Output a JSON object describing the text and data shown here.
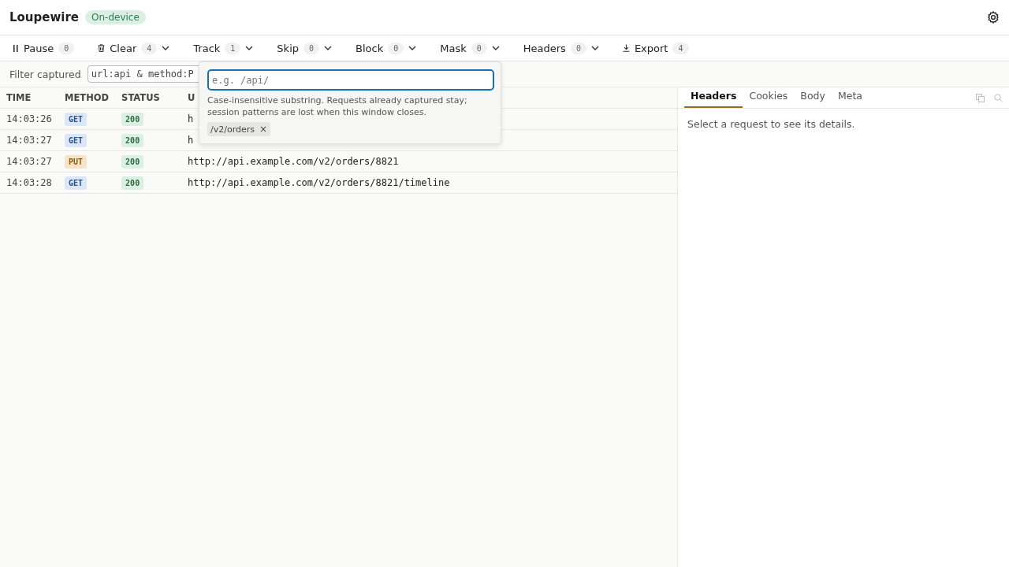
{
  "app": {
    "title": "Loupewire",
    "badge": "On-device"
  },
  "toolbar": [
    {
      "kind": "pause",
      "label": "Pause",
      "count": "0",
      "has_menu": false
    },
    {
      "kind": "trash",
      "label": "Clear",
      "count": "4",
      "has_menu": true
    },
    {
      "kind": "plain",
      "label": "Track",
      "count": "1",
      "has_menu": true
    },
    {
      "kind": "plain",
      "label": "Skip",
      "count": "0",
      "has_menu": true
    },
    {
      "kind": "plain",
      "label": "Block",
      "count": "0",
      "has_menu": true
    },
    {
      "kind": "plain",
      "label": "Mask",
      "count": "0",
      "has_menu": true
    },
    {
      "kind": "plain",
      "label": "Headers",
      "count": "0",
      "has_menu": true
    },
    {
      "kind": "download",
      "label": "Export",
      "count": "4",
      "has_menu": false
    }
  ],
  "filter": {
    "label": "Filter captured",
    "value": "url:api & method:P"
  },
  "table": {
    "columns": [
      "TIME",
      "METHOD",
      "STATUS",
      "U"
    ],
    "rows": [
      {
        "time": "14:03:26",
        "method": "GET",
        "color": "#dbe6f7",
        "status": "200",
        "url": "h"
      },
      {
        "time": "14:03:27",
        "method": "GET",
        "color": "#dbe6f7",
        "status": "200",
        "url": "h"
      },
      {
        "time": "14:03:27",
        "method": "PUT",
        "color": "#f6e4c8",
        "status": "200",
        "url": "http://api.example.com/v2/orders/8821"
      },
      {
        "time": "14:03:28",
        "method": "GET",
        "color": "#dbe6f7",
        "status": "200",
        "url": "http://api.example.com/v2/orders/8821/timeline"
      }
    ]
  },
  "popover": {
    "placeholder": "e.g. /api/",
    "hint": "Case-insensitive substring. Requests already captured stay; session patterns are lost when this window closes.",
    "chips": [
      "/v2/orders"
    ],
    "chip_remove": "×"
  },
  "details": {
    "tabs": [
      {
        "label": "Headers",
        "selected": true
      },
      {
        "label": "Cookies",
        "selected": false
      },
      {
        "label": "Body",
        "selected": false
      },
      {
        "label": "Meta",
        "selected": false
      }
    ],
    "empty": "Select a request to see its details."
  }
}
